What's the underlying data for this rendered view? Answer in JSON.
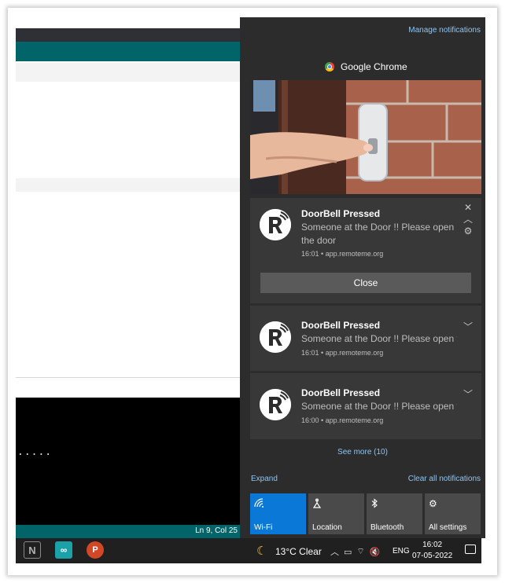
{
  "background_app": {
    "status_text": "Ln 9, Col 25",
    "console_text": "....."
  },
  "action_center": {
    "manage_link": "Manage notifications",
    "app_name": "Google Chrome",
    "notifications": [
      {
        "title": "DoorBell Pressed",
        "body": "Someone at the Door !! Please open the door",
        "meta": "16:01 • app.remoteme.org",
        "close_label": "Close"
      },
      {
        "title": "DoorBell Pressed",
        "body": "Someone at the Door !! Please open t",
        "meta": "16:01 • app.remoteme.org"
      },
      {
        "title": "DoorBell Pressed",
        "body": "Someone at the Door !! Please open t",
        "meta": "16:00 • app.remoteme.org"
      }
    ],
    "see_more": "See more (10)",
    "expand": "Expand",
    "clear_all": "Clear all notifications",
    "quick_actions": [
      {
        "label": "Wi-Fi",
        "icon": "wifi-icon",
        "active": true
      },
      {
        "label": "Location",
        "icon": "location-icon",
        "active": false
      },
      {
        "label": "Bluetooth",
        "icon": "bluetooth-icon",
        "active": false
      },
      {
        "label": "All settings",
        "icon": "gear-icon",
        "active": false
      }
    ]
  },
  "taskbar": {
    "weather": "13°C  Clear",
    "language": "ENG",
    "time": "16:02",
    "date": "07-05-2022"
  },
  "colors": {
    "action_center_bg": "#2c2c2c",
    "card_bg": "#383838",
    "accent": "#0a78d7",
    "link": "#8fc4ef",
    "teal": "#006468"
  }
}
